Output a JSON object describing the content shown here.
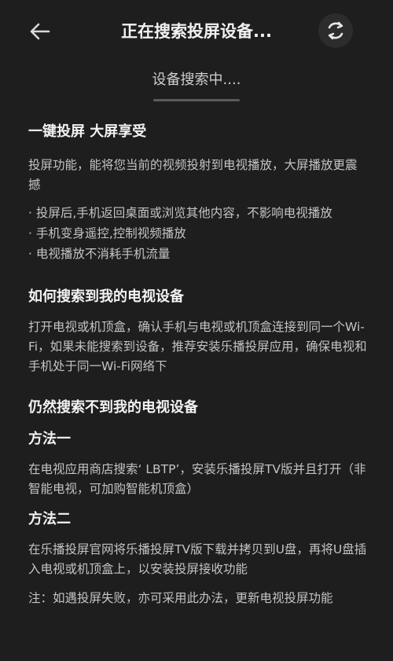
{
  "header": {
    "title": "正在搜索投屏设备...",
    "back_icon": "arrow-left-icon",
    "refresh_icon": "refresh-icon"
  },
  "status": {
    "text": "设备搜索中...."
  },
  "section1": {
    "heading": "一键投屏 大屏享受",
    "desc": "投屏功能，能将您当前的视频投射到电视播放，大屏播放更震撼",
    "bullets": [
      "· 投屏后,手机返回桌面或浏览其他内容，不影响电视播放",
      "· 手机变身遥控,控制视频播放",
      "· 电视播放不消耗手机流量"
    ]
  },
  "section2": {
    "heading": "如何搜索到我的电视设备",
    "desc": "打开电视或机顶盒，确认手机与电视或机顶盒连接到同一个Wi-Fi，如果未能搜索到设备，推荐安装乐播投屏应用，确保电视和手机处于同一Wi-Fi网络下"
  },
  "section3": {
    "heading": "仍然搜索不到我的电视设备",
    "method1_title": "方法一",
    "method1_desc": "在电视应用商店搜索‘ LBTP’，安装乐播投屏TV版并且打开（非智能电视，可加购智能机顶盒）",
    "method2_title": "方法二",
    "method2_desc": "在乐播投屏官网将乐播投屏TV版下载并拷贝到U盘，再将U盘插入电视或机顶盒上，以安装投屏接收功能",
    "note": "注：如遇投屏失败，亦可采用此办法，更新电视投屏功能"
  }
}
